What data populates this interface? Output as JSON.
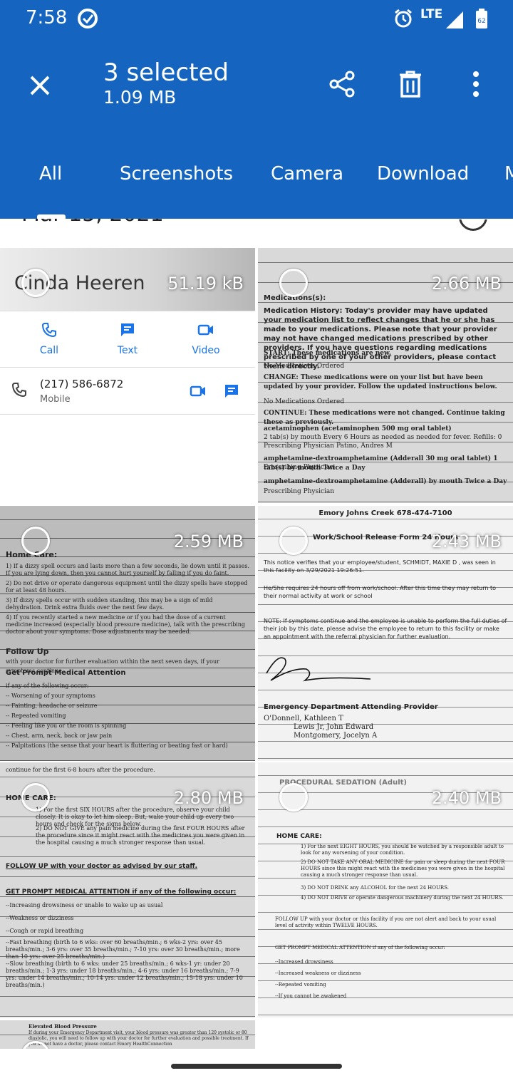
{
  "status": {
    "time": "7:58",
    "network": "LTE"
  },
  "appbar": {
    "title": "3 selected",
    "subtitle": "1.09 MB",
    "icons": [
      "close-icon",
      "share-icon",
      "delete-icon",
      "more-vert-icon"
    ],
    "color": "#1565c0"
  },
  "tabs": [
    {
      "label": "All",
      "selected": true
    },
    {
      "label": "Screenshots",
      "selected": false
    },
    {
      "label": "Camera",
      "selected": false
    },
    {
      "label": "Download",
      "selected": false
    },
    {
      "label": "M",
      "selected": false
    }
  ],
  "date_header": "Mar 15, 2021",
  "contact_tile": {
    "name": "Cinda Heeren",
    "size": "51.19 kB",
    "actions": [
      "Call",
      "Text",
      "Video"
    ],
    "phone": "(217) 586-6872",
    "phone_type": "Mobile"
  },
  "photos": [
    {
      "size": "2.66 MB",
      "lines": [
        "Medications(s):",
        "Medication History: Today's provider may have updated your medication list to reflect changes that he or she has made to your medications. Please note that your provider may not have changed medications prescribed by other providers. If you have questions regarding medications prescribed by one of your other providers, please contact them directly.",
        "START: These medications are new.",
        "No Medications Ordered",
        "CHANGE: These medications were on your list but have been updated by your provider. Follow the updated instructions below.",
        "No Medications Ordered",
        "CONTINUE: These medications were not changed. Continue taking these as previously.",
        "acetaminophen (acetaminophen 500 mg oral tablet)",
        "2 tab(s) by mouth Every 6 Hours as needed as needed for fever. Refills: 0",
        "Prescribing Physician Patino, Andres M",
        "amphetamine-dextroamphetamine (Adderall 30 mg oral tablet) 1 tab(s) by mouth Twice a Day",
        "Prescribing Physician",
        "amphetamine-dextroamphetamine (Adderall) by mouth Twice a Day",
        "Prescribing Physician"
      ]
    },
    {
      "size": "2.59 MB",
      "lines": [
        "Home Care:",
        "1) If a dizzy spell occurs and lasts more than a few seconds, lie down until it passes. If you are lying down, then you cannot hurt yourself by falling if you do faint.",
        "2) Do not drive or operate dangerous equipment until the dizzy spells have stopped for at least 48 hours.",
        "3) If dizzy spells occur with sudden standing, this may be a sign of mild dehydration. Drink extra fluids over the next few days.",
        "4) If you recently started a new medicine or if you had the dose of a current medicine increased (especially blood pressure medicine), talk with the prescribing doctor about your symptoms. Dose adjustments may be needed.",
        "Follow Up",
        "with your doctor for further evaluation within the next seven days, if your symptoms continue.",
        "Get Prompt Medical Attention",
        "if any of the following occur:",
        "-- Worsening of your symptoms",
        "-- Fainting, headache or seizure",
        "-- Repeated vomiting",
        "-- Feeling like you or the room is spinning",
        "-- Chest, arm, neck, back or jaw pain",
        "-- Palpitations (the sense that your heart is fluttering or beating fast or hard)"
      ]
    },
    {
      "size": "2.43 MB",
      "lines": [
        "Emory Johns Creek 678-474-7100",
        "Work/School Release Form 24 Hours",
        "This notice verifies that your employee/student, SCHMIDT, MAXIE D , was seen in this facility on 3/29/2021 19:26:51.",
        "He/She requires 24 hours off from work/school. After this time they may return to their normal activity at work or school",
        "NOTE: If symptoms continue and the employee is unable to perform the full duties of their job by this date, please advise the employee to return to this facility or make an appointment with the referral physician for further evaluation.",
        "Emergency Department Attending Provider",
        "O'Donnell, Kathleen T",
        "Lewis Jr, John Edward",
        "Montgomery, Jocelyn A"
      ]
    },
    {
      "size": "2.80 MB",
      "lines": [
        "continue for the first 6-8 hours after the procedure.",
        "HOME CARE:",
        "1) For the first SIX HOURS after the procedure, observe your child closely. It is okay to let him sleep. But, wake your child up every two hours and check for the signs below.",
        "2) DO NOT GIVE any pain medicine during the first FOUR HOURS after the procedure since it might react with the medicines you were given in the hospital causing a much stronger response than usual.",
        "FOLLOW UP with your doctor as advised by our staff.",
        "GET PROMPT MEDICAL ATTENTION if any of the following occur:",
        "--Increasing drowsiness or unable to wake up as usual",
        "--Weakness or dizziness",
        "--Cough or rapid breathing",
        "--Fast breathing (birth to 6 wks: over 60 breaths/min.; 6 wks-2 yrs: over 45 breaths/min.; 3-6 yrs: over 35 breaths/min.; 7-10 yrs: over 30 breaths/min.; more than 10 yrs: over 25 breaths/min.)",
        "--Slow breathing (birth to 6 wks: under 25 breaths/min.; 6 wks-1 yr: under 20 breaths/min.; 1-3 yrs: under 18 breaths/min.; 4-6 yrs: under 16 breaths/min.; 7-9 yrs: under 14 breaths/min.; 10-14 yrs: under 12 breaths/min.; 15-18 yrs: under 10 breaths/min.)"
      ]
    },
    {
      "size": "2.40 MB",
      "lines": [
        "PROCEDURAL SEDATION (Adult)",
        "HOME CARE:",
        "1) For the next EIGHT HOURS, you should be watched by a responsible adult to look for any worsening of your condition.",
        "2) DO NOT TAKE ANY ORAL MEDICINE for pain or sleep during the next FOUR HOURS since this might react with the medicines you were given in the hospital causing a much stronger response than usual.",
        "3) DO NOT DRINK any ALCOHOL for the next 24 HOURS.",
        "4) DO NOT DRIVE or operate dangerous machinery during the next 24 HOURS.",
        "FOLLOW UP with your doctor or this facility if you are not alert and back to your usual level of activity within TWELVE HOURS.",
        "GET PROMPT MEDICAL ATTENTION if any of the following occur:",
        "--Increased drowsiness",
        "--Increased weakness or dizziness",
        "--Repeated vomiting",
        "--If you cannot be awakened"
      ]
    },
    {
      "size": "",
      "lines": [
        "Elevated Blood Pressure",
        "If during your Emergency Department visit, your blood pressure was greater than 120 systolic or 80 diastolic, you will need to follow up with your doctor for further evaluation and possible treatment. If you do not have a doctor, please contact Emory HealthConnection"
      ]
    }
  ]
}
